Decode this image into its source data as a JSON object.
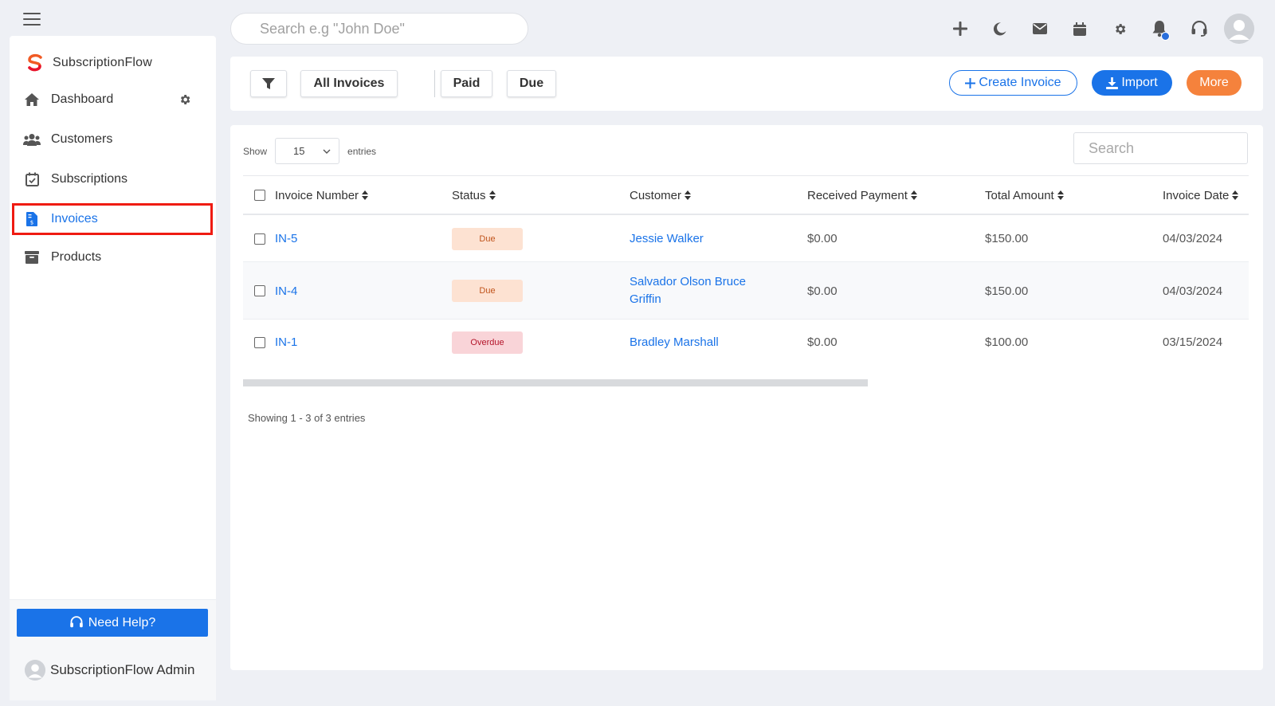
{
  "header": {
    "search_placeholder": "Search e.g \"John Doe\"",
    "icons": [
      "plus-icon",
      "moon-icon",
      "mail-icon",
      "calendar-icon",
      "gear-icon",
      "bell-icon",
      "headset-icon",
      "user-avatar"
    ],
    "accent_color": "#1a73e8"
  },
  "sidebar": {
    "brand": "SubscriptionFlow",
    "items": [
      {
        "label": "Dashboard",
        "icon": "home-icon"
      },
      {
        "label": "Customers",
        "icon": "users-icon"
      },
      {
        "label": "Subscriptions",
        "icon": "calendar-check-icon"
      },
      {
        "label": "Invoices",
        "icon": "invoice-icon",
        "active": true
      },
      {
        "label": "Products",
        "icon": "archive-icon"
      }
    ],
    "help_label": "Need Help?",
    "admin_name": "SubscriptionFlow Admin"
  },
  "toolbar": {
    "filters": [
      "All Invoices",
      "Paid",
      "Due"
    ],
    "create_label": "Create Invoice",
    "import_label": "Import",
    "more_label": "More"
  },
  "table": {
    "show_label": "Show",
    "entries_value": "15",
    "entries_label": "entries",
    "search_placeholder": "Search",
    "columns": [
      "Invoice Number",
      "Status",
      "Customer",
      "Received Payment",
      "Total Amount",
      "Invoice Date"
    ],
    "rows": [
      {
        "invoice": "IN-5",
        "status": "Due",
        "customer": "Jessie Walker",
        "received": "$0.00",
        "total": "$150.00",
        "date": "04/03/2024"
      },
      {
        "invoice": "IN-4",
        "status": "Due",
        "customer": "Salvador Olson Bruce Griffin",
        "received": "$0.00",
        "total": "$150.00",
        "date": "04/03/2024"
      },
      {
        "invoice": "IN-1",
        "status": "Overdue",
        "customer": "Bradley Marshall",
        "received": "$0.00",
        "total": "$100.00",
        "date": "03/15/2024"
      }
    ],
    "footer": "Showing 1 - 3 of 3 entries"
  }
}
